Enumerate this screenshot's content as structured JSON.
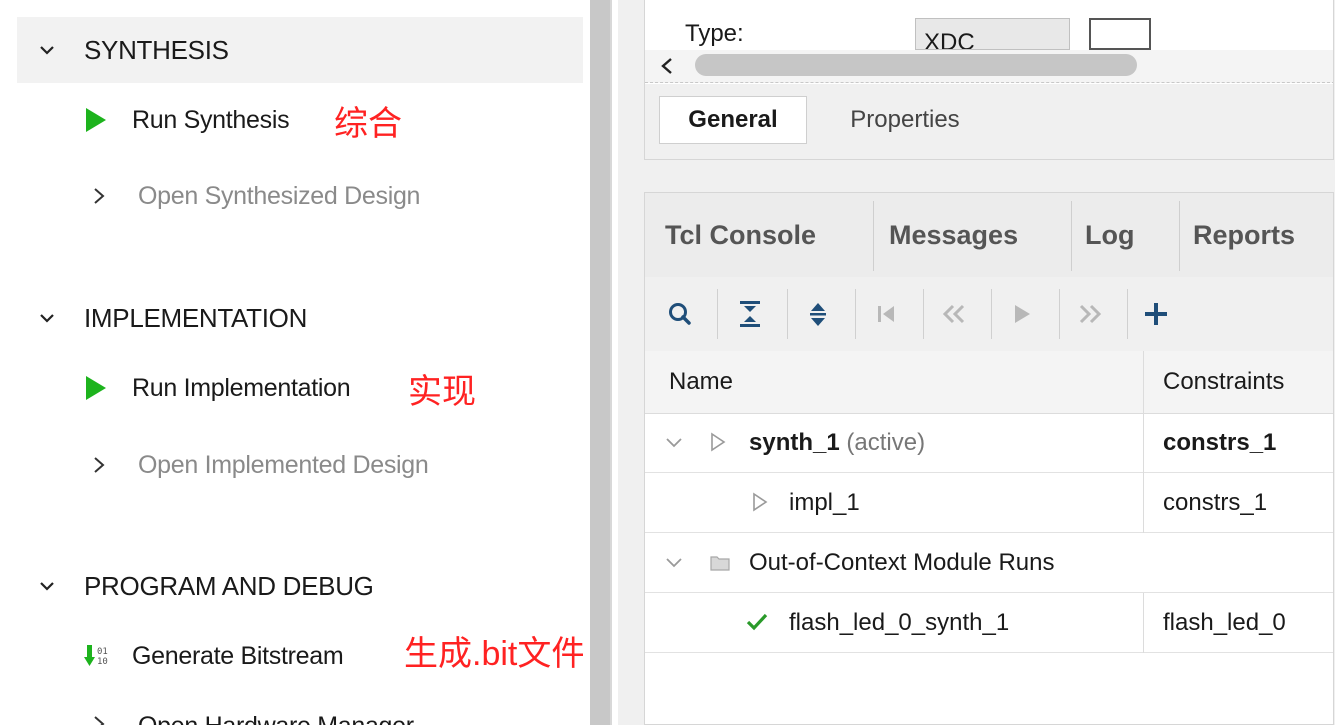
{
  "navigator": {
    "synthesis": {
      "header": "SYNTHESIS",
      "run": "Run Synthesis",
      "run_note": "综合",
      "open": "Open Synthesized Design"
    },
    "implementation": {
      "header": "IMPLEMENTATION",
      "run": "Run Implementation",
      "run_note": "实现",
      "open": "Open Implemented Design"
    },
    "program_debug": {
      "header": "PROGRAM AND DEBUG",
      "generate": "Generate Bitstream",
      "generate_note": "生成.bit文件",
      "open_hw_partial": "Open Hardware Manager"
    }
  },
  "source_properties": {
    "type_label": "Type:",
    "type_value": "XDC",
    "tabs": [
      "General",
      "Properties"
    ]
  },
  "console": {
    "tabs": [
      "Tcl Console",
      "Messages",
      "Log",
      "Reports"
    ],
    "toolbar_icons": [
      "search-icon",
      "collapse-all-icon",
      "expand-all-icon",
      "first-icon",
      "previous-icon",
      "play-icon",
      "next-icon",
      "add-icon"
    ],
    "columns": {
      "name": "Name",
      "constraints": "Constraints"
    },
    "rows": [
      {
        "name": "synth_1",
        "suffix": "(active)",
        "constraints": "constrs_1"
      },
      {
        "name": "impl_1",
        "constraints": "constrs_1"
      },
      {
        "name": "Out-of-Context Module Runs"
      },
      {
        "name": "flash_led_0_synth_1",
        "constraints": "flash_led_0"
      }
    ]
  },
  "colors": {
    "run_green": "#1db31d",
    "annotation_red": "#ff2222",
    "check_green": "#2a9a2a",
    "icon_blue": "#1f4e79"
  }
}
